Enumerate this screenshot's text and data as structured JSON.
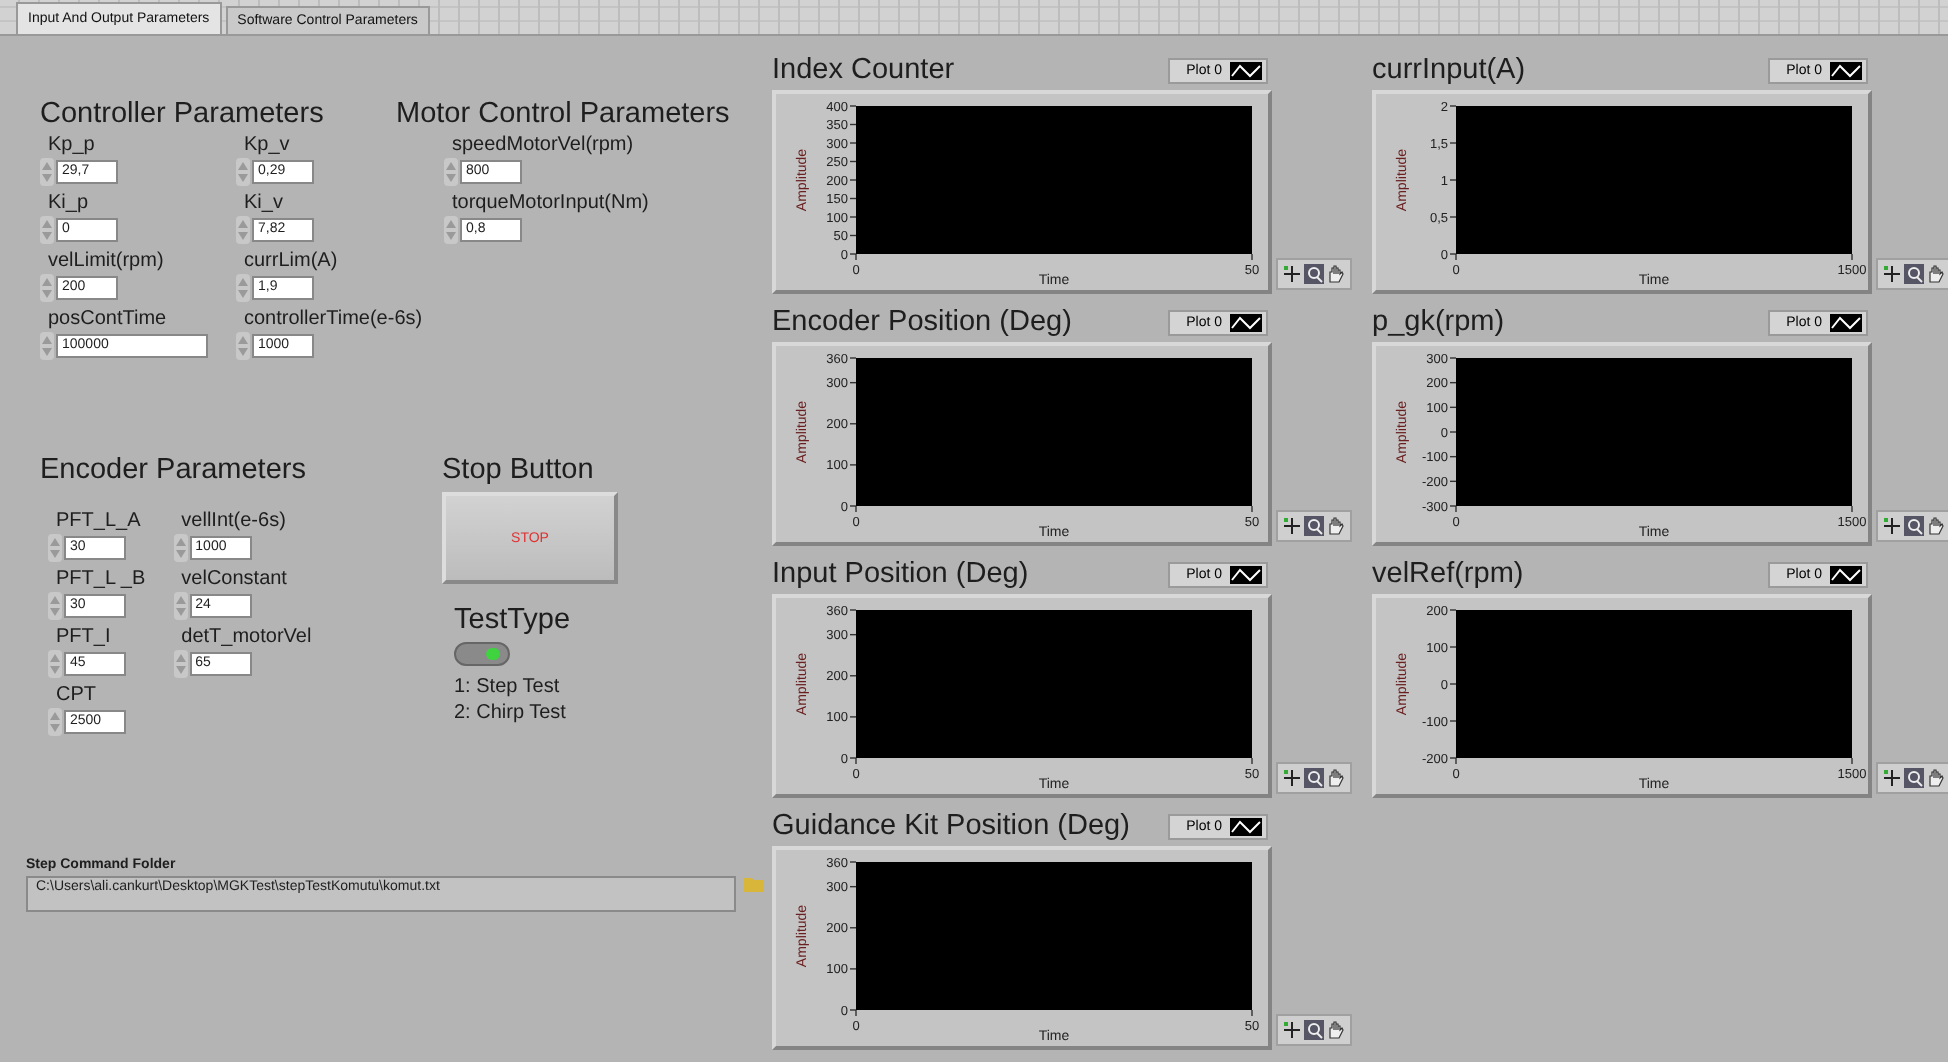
{
  "tabs": [
    {
      "label": "Input And Output Parameters",
      "selected": true
    },
    {
      "label": "Software Control Parameters",
      "selected": false
    }
  ],
  "controller_parameters": {
    "title": "Controller Parameters",
    "columns": [
      [
        {
          "label": "Kp_p",
          "value": "29,7"
        },
        {
          "label": "Ki_p",
          "value": "0"
        },
        {
          "label": "velLimit(rpm)",
          "value": "200"
        },
        {
          "label": "posContTime",
          "value": "100000"
        }
      ],
      [
        {
          "label": "Kp_v",
          "value": "0,29"
        },
        {
          "label": "Ki_v",
          "value": "7,82"
        },
        {
          "label": "currLim(A)",
          "value": "1,9"
        },
        {
          "label": "controllerTime(e-6s)",
          "value": "1000"
        }
      ]
    ]
  },
  "motor_control_parameters": {
    "title": "Motor Control Parameters",
    "controls": [
      {
        "label": "speedMotorVel(rpm)",
        "value": "800"
      },
      {
        "label": "torqueMotorInput(Nm)",
        "value": "0,8"
      }
    ]
  },
  "encoder_parameters": {
    "title": "Encoder Parameters",
    "columns": [
      [
        {
          "label": "PFT_L_A",
          "value": "30"
        },
        {
          "label": "PFT_L _B",
          "value": "30"
        },
        {
          "label": "PFT_I",
          "value": "45"
        },
        {
          "label": "CPT",
          "value": "2500"
        }
      ],
      [
        {
          "label": "vellInt(e-6s)",
          "value": "1000"
        },
        {
          "label": "velConstant",
          "value": "24"
        },
        {
          "label": "detT_motorVel",
          "value": "65"
        }
      ]
    ]
  },
  "stop_button": {
    "title": "Stop Button",
    "label": "STOP"
  },
  "test_type": {
    "title": "TestType",
    "on": true,
    "options": [
      "1: Step Test",
      "2: Chirp Test"
    ]
  },
  "step_command_folder": {
    "label": "Step Command Folder",
    "value": "C:\\Users\\ali.cankurt\\Desktop\\MGKTest\\stepTestKomutu\\komut.txt"
  },
  "graphs": [
    {
      "title": "Index Counter",
      "legend": "Plot 0",
      "chart_data": {
        "type": "line",
        "xlabel": "Time",
        "ylabel": "Amplitude",
        "xlim": [
          0,
          50
        ],
        "ylim": [
          0,
          400
        ],
        "xticks": [
          0,
          50
        ],
        "yticks": [
          0,
          50,
          100,
          150,
          200,
          250,
          300,
          350,
          400
        ]
      }
    },
    {
      "title": "currInput(A)",
      "legend": "Plot 0",
      "chart_data": {
        "type": "line",
        "xlabel": "Time",
        "ylabel": "Amplitude",
        "xlim": [
          0,
          1500
        ],
        "ylim": [
          0,
          2
        ],
        "xticks": [
          0,
          1500
        ],
        "yticks": [
          0,
          {
            "value": 0.5,
            "label": "0,5"
          },
          1,
          {
            "value": 1.5,
            "label": "1,5"
          },
          2
        ]
      }
    },
    {
      "title": "Encoder Position (Deg)",
      "legend": "Plot 0",
      "chart_data": {
        "type": "line",
        "xlabel": "Time",
        "ylabel": "Amplitude",
        "xlim": [
          0,
          50
        ],
        "ylim": [
          0,
          360
        ],
        "xticks": [
          0,
          50
        ],
        "yticks": [
          0,
          100,
          200,
          300,
          360
        ]
      }
    },
    {
      "title": "p_gk(rpm)",
      "legend": "Plot 0",
      "chart_data": {
        "type": "line",
        "xlabel": "Time",
        "ylabel": "Amplitude",
        "xlim": [
          0,
          1500
        ],
        "ylim": [
          -300,
          300
        ],
        "xticks": [
          0,
          1500
        ],
        "yticks": [
          -300,
          -200,
          -100,
          0,
          100,
          200,
          300
        ]
      }
    },
    {
      "title": "Input Position (Deg)",
      "legend": "Plot 0",
      "chart_data": {
        "type": "line",
        "xlabel": "Time",
        "ylabel": "Amplitude",
        "xlim": [
          0,
          50
        ],
        "ylim": [
          0,
          360
        ],
        "xticks": [
          0,
          50
        ],
        "yticks": [
          0,
          100,
          200,
          300,
          360
        ]
      }
    },
    {
      "title": "velRef(rpm)",
      "legend": "Plot 0",
      "chart_data": {
        "type": "line",
        "xlabel": "Time",
        "ylabel": "Amplitude",
        "xlim": [
          0,
          1500
        ],
        "ylim": [
          -200,
          200
        ],
        "xticks": [
          0,
          1500
        ],
        "yticks": [
          -200,
          -100,
          0,
          100,
          200
        ]
      }
    },
    {
      "title": "Guidance Kit Position (Deg)",
      "legend": "Plot 0",
      "chart_data": {
        "type": "line",
        "xlabel": "Time",
        "ylabel": "Amplitude",
        "xlim": [
          0,
          50
        ],
        "ylim": [
          0,
          360
        ],
        "xticks": [
          0,
          50
        ],
        "yticks": [
          0,
          100,
          200,
          300,
          360
        ]
      }
    }
  ]
}
